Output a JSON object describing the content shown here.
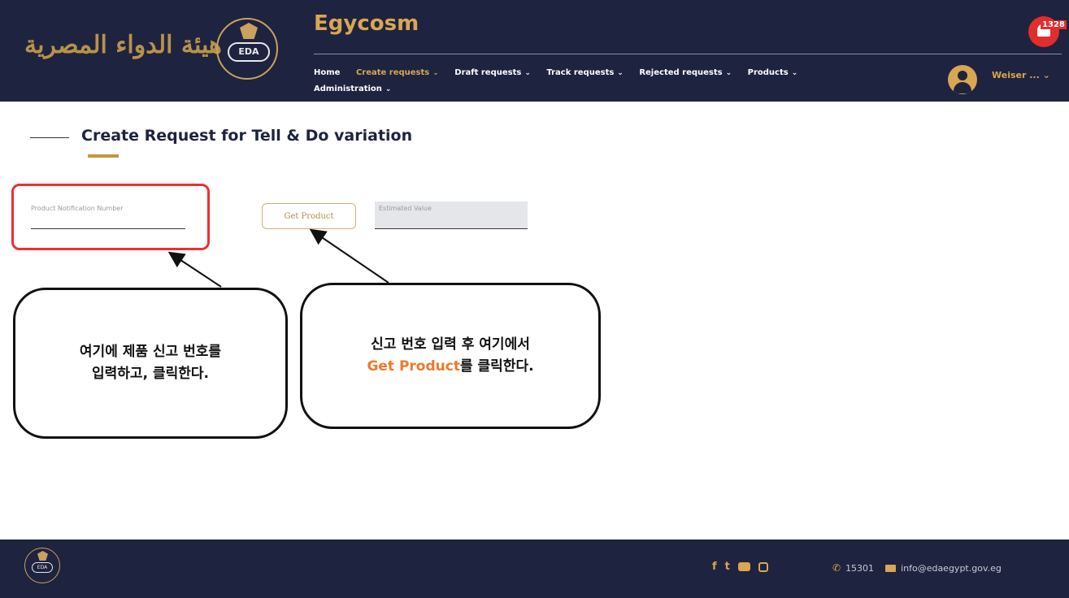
{
  "header": {
    "arabic_logo_text": "هيئة الدواء المصرية",
    "emblem_text": "EDA",
    "app_title": "Egycosm",
    "nav": [
      {
        "label": "Home",
        "has_dropdown": false,
        "active": false
      },
      {
        "label": "Create requests",
        "has_dropdown": true,
        "active": true
      },
      {
        "label": "Draft requests",
        "has_dropdown": true,
        "active": false
      },
      {
        "label": "Track requests",
        "has_dropdown": true,
        "active": false
      },
      {
        "label": "Rejected requests",
        "has_dropdown": true,
        "active": false
      },
      {
        "label": "Products",
        "has_dropdown": true,
        "active": false
      },
      {
        "label": "Administration",
        "has_dropdown": true,
        "active": false
      }
    ],
    "notification_count": "1328",
    "user_name": "Weiser ..."
  },
  "page": {
    "title": "Create Request for Tell & Do variation"
  },
  "form": {
    "product_notification_label": "Product Notification Number",
    "product_notification_value": "",
    "get_product_label": "Get Product",
    "estimated_value_label": "Estimated Value"
  },
  "callouts": {
    "left_line1": "여기에 제품 신고 번호를",
    "left_line2": "입력하고, 클릭한다.",
    "right_line1": "신고 번호 입력 후 여기에서",
    "right_line2_highlight": "Get Product",
    "right_line2_rest": "를 클릭한다."
  },
  "footer": {
    "phone": "15301",
    "email": "info@edaegypt.gov.eg"
  },
  "colors": {
    "navy": "#1e2340",
    "gold": "#d9a651",
    "highlight_red": "#ec3030",
    "accent_orange": "#ec7a2a"
  },
  "icons": {
    "chevron": "chevron-down-icon",
    "bell": "bell-icon",
    "user": "user-icon",
    "facebook": "facebook-icon",
    "twitter": "twitter-icon",
    "youtube": "youtube-icon",
    "instagram": "instagram-icon",
    "phone": "phone-icon",
    "email": "email-icon"
  }
}
